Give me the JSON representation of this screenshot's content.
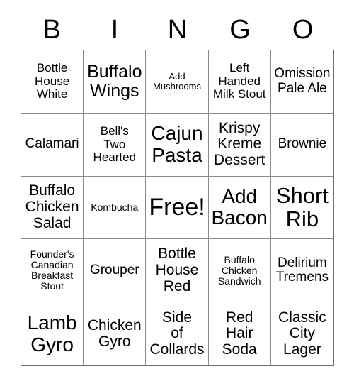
{
  "card": {
    "type": "bingo-card",
    "header_letters": [
      "B",
      "I",
      "N",
      "G",
      "O"
    ],
    "columns": 5,
    "rows": 5,
    "free_space": "Free!",
    "text_color": "#000000",
    "background_color": "#ffffff",
    "grid_line_color": "#8a8a8a"
  },
  "squares": [
    {
      "text": "Bottle\nHouse\nWhite",
      "size": "md"
    },
    {
      "text": "Buffalo\nWings",
      "size": "2xl"
    },
    {
      "text": "Add\nMushrooms",
      "size": "xs"
    },
    {
      "text": "Left\nHanded\nMilk Stout",
      "size": "md"
    },
    {
      "text": "Omission\nPale Ale",
      "size": "lg"
    },
    {
      "text": "Calamari",
      "size": "lg"
    },
    {
      "text": "Bell's\nTwo\nHearted",
      "size": "md"
    },
    {
      "text": "Cajun\nPasta",
      "size": "3xl"
    },
    {
      "text": "Krispy\nKreme\nDessert",
      "size": "xl"
    },
    {
      "text": "Brownie",
      "size": "lg"
    },
    {
      "text": "Buffalo\nChicken\nSalad",
      "size": "xl"
    },
    {
      "text": "Kombucha",
      "size": "sm"
    },
    {
      "text": "Free!",
      "size": "free"
    },
    {
      "text": "Add\nBacon",
      "size": "3xl"
    },
    {
      "text": "Short\nRib",
      "size": "4xl"
    },
    {
      "text": "Founder's\nCanadian\nBreakfast\nStout",
      "size": "sm"
    },
    {
      "text": "Grouper",
      "size": "lg"
    },
    {
      "text": "Bottle\nHouse\nRed",
      "size": "xl"
    },
    {
      "text": "Buffalo\nChicken\nSandwich",
      "size": "sm"
    },
    {
      "text": "Delirium\nTremens",
      "size": "lg"
    },
    {
      "text": "Lamb\nGyro",
      "size": "3xl"
    },
    {
      "text": "Chicken\nGyro",
      "size": "xl"
    },
    {
      "text": "Side\nof\nCollards",
      "size": "xl"
    },
    {
      "text": "Red\nHair\nSoda",
      "size": "xl"
    },
    {
      "text": "Classic\nCity\nLager",
      "size": "xl"
    }
  ]
}
